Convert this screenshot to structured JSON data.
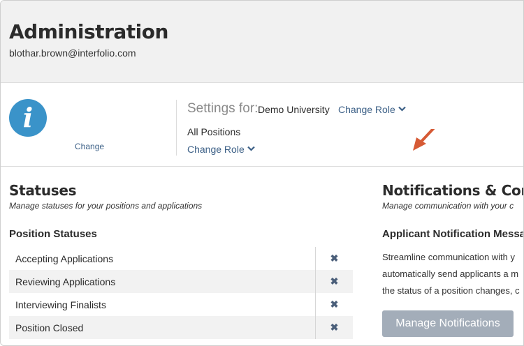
{
  "header": {
    "title": "Administration",
    "email": "blothar.brown@interfolio.com"
  },
  "settings": {
    "change_label": "Change",
    "settings_for_label": "Settings for:",
    "organization": "Demo University",
    "change_role_label": "Change Role",
    "position_scope": "All Positions",
    "change_role_label_2": "Change Role"
  },
  "statuses": {
    "title": "Statuses",
    "subtitle": "Manage statuses for your positions and applications",
    "position_statuses_heading": "Position Statuses",
    "items": [
      {
        "label": "Accepting Applications"
      },
      {
        "label": "Reviewing Applications"
      },
      {
        "label": "Interviewing Finalists"
      },
      {
        "label": "Position Closed"
      }
    ],
    "remove_glyph": "✖"
  },
  "notifications": {
    "title": "Notifications & Com",
    "subtitle": "Manage communication with your c",
    "applicant_heading": "Applicant Notification Messag",
    "body_lines": [
      "Streamline communication with y",
      "automatically send applicants a m",
      "the status of a position changes, c"
    ],
    "button_label": "Manage Notifications"
  },
  "colors": {
    "link": "#3b5f86",
    "info_icon": "#3a93c9",
    "button_bg": "#a3adb9",
    "arrow": "#d65a35"
  },
  "icons": {
    "info": "info-icon",
    "chevron": "chevron-down-icon",
    "remove": "remove-icon",
    "annotation": "arrow-annotation"
  }
}
